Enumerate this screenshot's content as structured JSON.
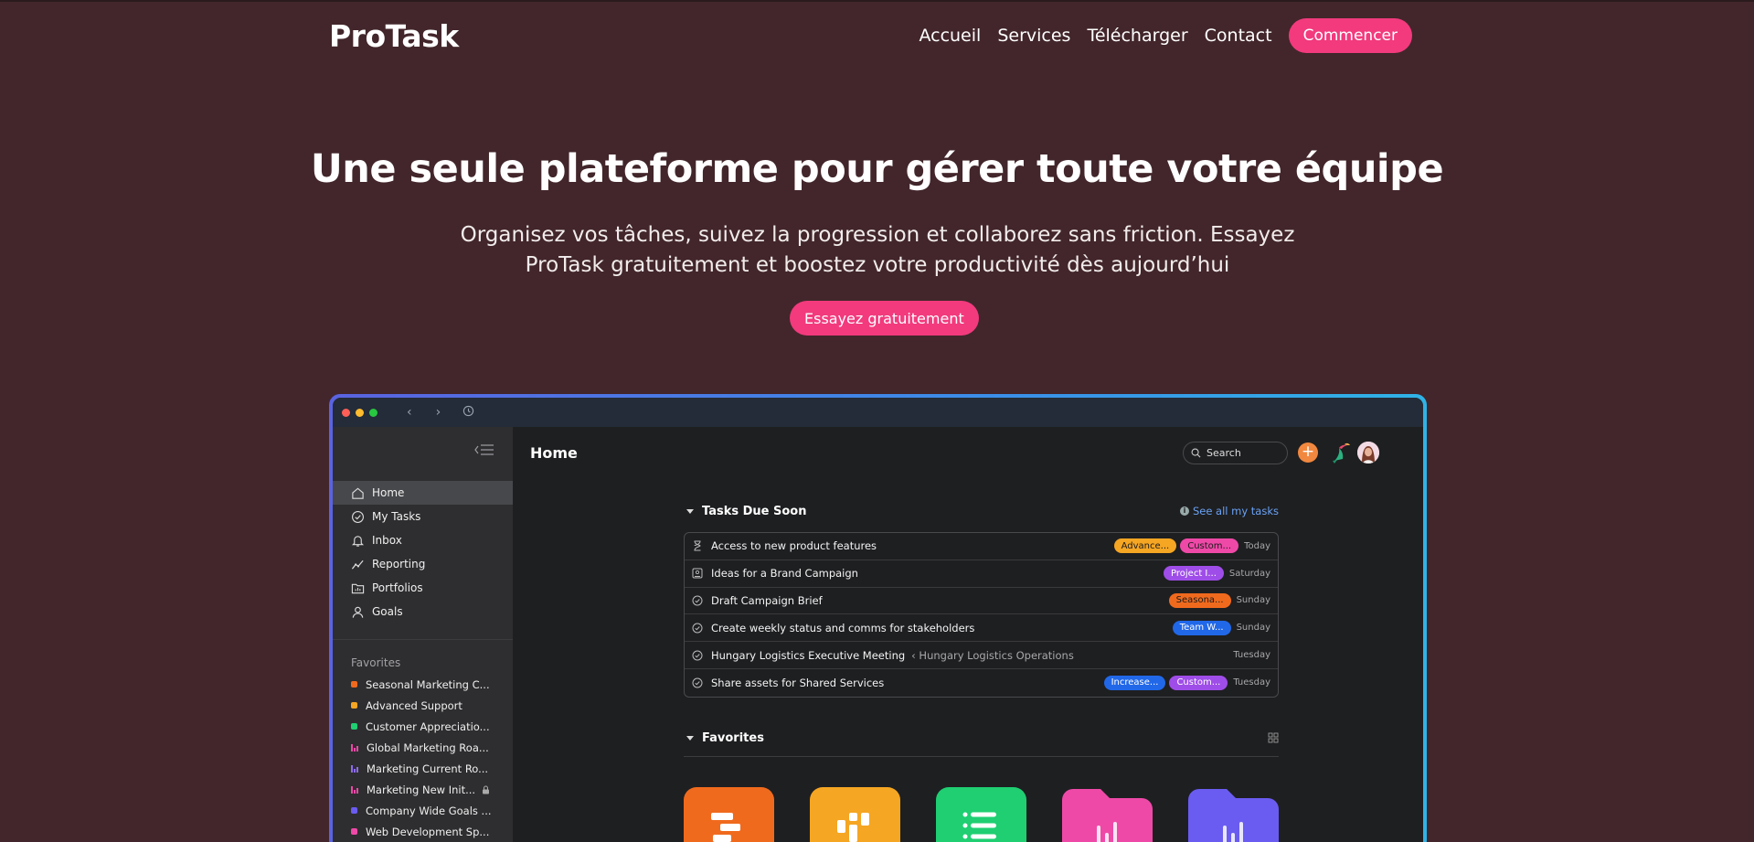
{
  "site": {
    "logo": "ProTask",
    "nav": [
      "Accueil",
      "Services",
      "Télécharger",
      "Contact"
    ],
    "cta_label": "Commencer"
  },
  "hero": {
    "title": "Une seule plateforme pour gérer toute votre équipe",
    "subtitle_line1": "Organisez vos tâches, suivez la progression et collaborez sans friction. Essayez",
    "subtitle_line2": "ProTask gratuitement et boostez votre productivité dès aujourd’hui",
    "cta_label": "Essayez gratuitement"
  },
  "app": {
    "sidebar": {
      "items": [
        {
          "label": "Home",
          "icon": "home-icon",
          "active": true
        },
        {
          "label": "My Tasks",
          "icon": "check-circle-icon"
        },
        {
          "label": "Inbox",
          "icon": "bell-icon"
        },
        {
          "label": "Reporting",
          "icon": "chart-line-icon"
        },
        {
          "label": "Portfolios",
          "icon": "folder-icon"
        },
        {
          "label": "Goals",
          "icon": "person-icon"
        }
      ],
      "favorites_title": "Favorites",
      "favorites": [
        {
          "label": "Seasonal Marketing C...",
          "color": "#f06a1d",
          "kind": "square"
        },
        {
          "label": "Advanced Support",
          "color": "#f5a623",
          "kind": "square"
        },
        {
          "label": "Customer Appreciatio...",
          "color": "#1fcf72",
          "kind": "square"
        },
        {
          "label": "Global Marketing Roa...",
          "color": "#ef49a8",
          "kind": "bars"
        },
        {
          "label": "Marketing Current Ro...",
          "color": "#8d6cf0",
          "kind": "bars"
        },
        {
          "label": "Marketing New Init...",
          "color": "#ef49a8",
          "kind": "bars",
          "locked": true
        },
        {
          "label": "Company Wide Goals ...",
          "color": "#6a5cf0",
          "kind": "square"
        },
        {
          "label": "Web Development Sp...",
          "color": "#ef49a8",
          "kind": "square"
        }
      ]
    },
    "header": {
      "title": "Home",
      "search_label": "Search"
    },
    "tasks_section": {
      "title": "Tasks Due Soon",
      "see_all": "See all my tasks",
      "rows": [
        {
          "name": "Access to new product features",
          "project": "",
          "icon": "hourglass-icon",
          "tags": [
            {
              "label": "Advance...",
              "color": "#f5a623"
            },
            {
              "label": "Custom...",
              "color": "#ef49a8"
            }
          ],
          "due": "Today"
        },
        {
          "name": "Ideas for a Brand Campaign",
          "project": "",
          "icon": "approval-icon",
          "tags": [
            {
              "label": "Project I...",
              "color": "#9f4de8"
            }
          ],
          "due": "Saturday"
        },
        {
          "name": "Draft Campaign Brief",
          "project": "",
          "icon": "check-circle-icon",
          "tags": [
            {
              "label": "Seasona...",
              "color": "#f06a1d"
            }
          ],
          "due": "Sunday"
        },
        {
          "name": "Create weekly status and comms for stakeholders",
          "project": "",
          "icon": "check-circle-icon",
          "tags": [
            {
              "label": "Team W...",
              "color": "#2168e8"
            }
          ],
          "due": "Sunday"
        },
        {
          "name": "Hungary Logistics Executive Meeting",
          "project": "‹ Hungary Logistics Operations",
          "icon": "check-circle-icon",
          "tags": [],
          "due": "Tuesday"
        },
        {
          "name": "Share assets for Shared Services",
          "project": "",
          "icon": "check-circle-icon",
          "tags": [
            {
              "label": "Increase...",
              "color": "#2168e8"
            },
            {
              "label": "Custom...",
              "color": "#9f4de8"
            }
          ],
          "due": "Tuesday"
        }
      ]
    },
    "favorites_section": {
      "title": "Favorites",
      "tiles": [
        {
          "color": "#f06a1d",
          "icon": "timeline-icon"
        },
        {
          "color": "#f5a623",
          "icon": "board-icon"
        },
        {
          "color": "#1fcf72",
          "icon": "list-icon"
        },
        {
          "color": "#ef49a8",
          "icon": "chart-folder-icon"
        },
        {
          "color": "#6a5cf0",
          "icon": "chart-folder-icon"
        }
      ]
    }
  }
}
